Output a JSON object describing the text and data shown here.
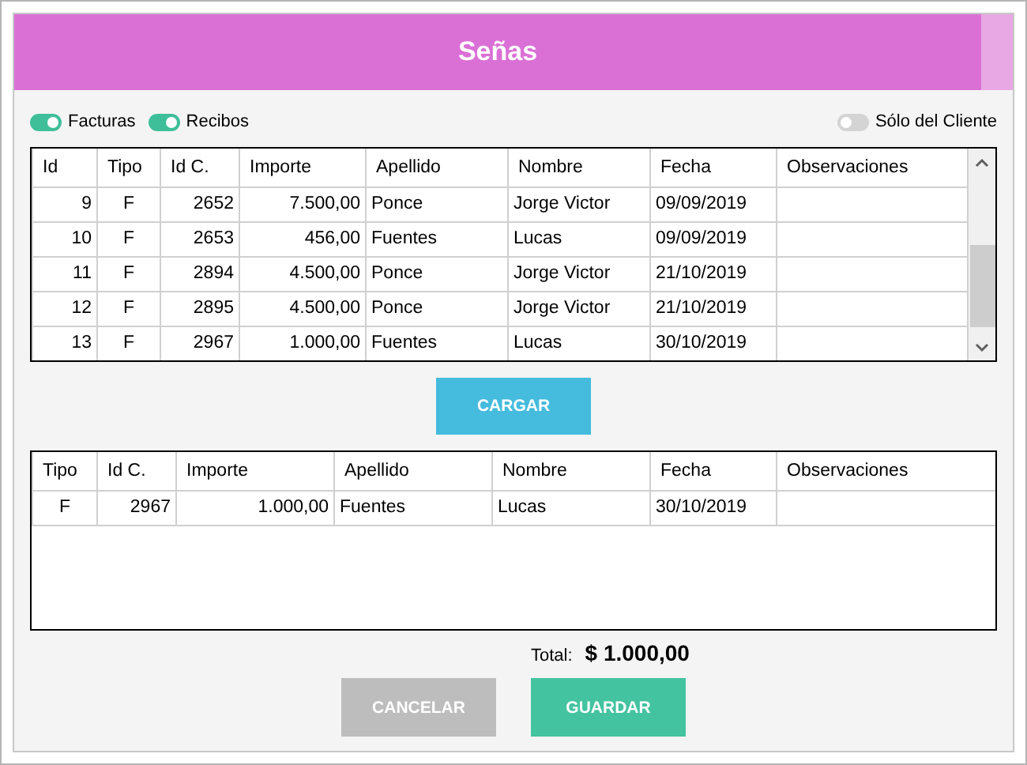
{
  "header": {
    "title": "Señas"
  },
  "filters": [
    {
      "label": "Facturas",
      "on": true
    },
    {
      "label": "Recibos",
      "on": true
    },
    {
      "label": "Sólo del Cliente",
      "on": false
    }
  ],
  "table": {
    "columns": [
      "Id",
      "Tipo",
      "Id C.",
      "Importe",
      "Apellido",
      "Nombre",
      "Fecha",
      "Observaciones"
    ],
    "rows": [
      [
        "9",
        "F",
        "2652",
        "7.500,00",
        "Ponce",
        "Jorge Victor",
        "09/09/2019",
        ""
      ],
      [
        "10",
        "F",
        "2653",
        "456,00",
        "Fuentes",
        "Lucas",
        "09/09/2019",
        ""
      ],
      [
        "11",
        "F",
        "2894",
        "4.500,00",
        "Ponce",
        "Jorge Victor",
        "21/10/2019",
        ""
      ],
      [
        "12",
        "F",
        "2895",
        "4.500,00",
        "Ponce",
        "Jorge Victor",
        "21/10/2019",
        ""
      ],
      [
        "13",
        "F",
        "2967",
        "1.000,00",
        "Fuentes",
        "Lucas",
        "30/10/2019",
        ""
      ]
    ]
  },
  "load_button": "CARGAR",
  "selected_table": {
    "columns": [
      "Tipo",
      "Id C.",
      "Importe",
      "Apellido",
      "Nombre",
      "Fecha",
      "Observaciones"
    ],
    "rows": [
      [
        "F",
        "2967",
        "1.000,00",
        "Fuentes",
        "Lucas",
        "30/10/2019",
        ""
      ]
    ]
  },
  "total": {
    "label": "Total:",
    "value": "$ 1.000,00"
  },
  "buttons": [
    {
      "label": "CANCELAR",
      "kind": "cancel"
    },
    {
      "label": "GUARDAR",
      "kind": "save"
    }
  ]
}
